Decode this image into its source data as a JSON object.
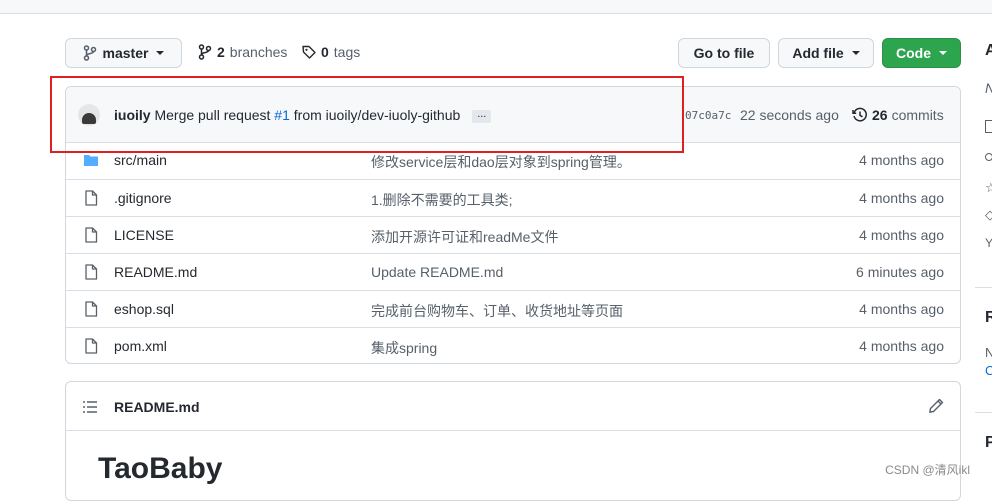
{
  "branch_button": {
    "label": "master"
  },
  "branches": {
    "count": "2",
    "label": "branches"
  },
  "tags": {
    "count": "0",
    "label": "tags"
  },
  "toolbar": {
    "goto_file": "Go to file",
    "add_file": "Add file",
    "code": "Code"
  },
  "latest_commit": {
    "author": "iuoily",
    "message_pre": "Merge pull request",
    "pr": "#1",
    "message_post": "from iuoily/dev-iuoly-github",
    "ellipsis": "...",
    "sha": "07c0a7c",
    "time": "22 seconds ago",
    "commit_count": "26",
    "commit_label": "commits"
  },
  "files": [
    {
      "type": "folder",
      "name": "src/main",
      "message": "修改service层和dao层对象到spring管理。",
      "age": "4 months ago"
    },
    {
      "type": "file",
      "name": ".gitignore",
      "message": "1.删除不需要的工具类;",
      "age": "4 months ago"
    },
    {
      "type": "file",
      "name": "LICENSE",
      "message": "添加开源许可证和readMe文件",
      "age": "4 months ago"
    },
    {
      "type": "file",
      "name": "README.md",
      "message": "Update README.md",
      "age": "6 minutes ago"
    },
    {
      "type": "file",
      "name": "eshop.sql",
      "message": "完成前台购物车、订单、收货地址等页面",
      "age": "4 months ago"
    },
    {
      "type": "file",
      "name": "pom.xml",
      "message": "集成spring",
      "age": "4 months ago"
    }
  ],
  "readme": {
    "title": "README.md",
    "heading": "TaoBaby"
  },
  "sidebar": {
    "frag_a": "A",
    "frag_n": "N",
    "frag_r": "R",
    "frag_n2": "N",
    "frag_c": "C",
    "frag_p": "P"
  },
  "watermark": "CSDN @清风ikl",
  "colors": {
    "accent_green": "#2da44e",
    "link_blue": "#0969da",
    "highlight_red": "#e02020",
    "folder_blue": "#54aeff"
  }
}
